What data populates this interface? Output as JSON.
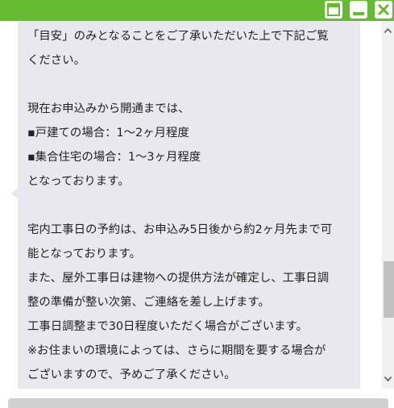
{
  "window": {
    "controls": [
      "restore-icon",
      "minimize-icon",
      "close-icon"
    ],
    "titlebar_color": "#66b933"
  },
  "message": {
    "lines": [
      "「目安」のみとなることをご了承いただいた上で下記ご覧",
      "ください。",
      "",
      "現在お申込みから開通までは、",
      "▪戸建ての場合：1～2ヶ月程度",
      "▪集合住宅の場合：1～3ヶ月程度",
      "となっております。",
      "",
      "宅内工事日の予約は、お申込み5日後から約2ヶ月先まで可",
      "能となっております。",
      "また、屋外工事日は建物への提供方法が確定し、工事日調",
      "整の準備が整い次第、ご連絡を差し上げます。",
      "工事日調整まで30日程度いただく場合がございます。",
      "※お住まいの環境によっては、さらに期間を要する場合が",
      "ございますので、予めご了承ください。"
    ],
    "bubble_color": "#e8e8ee"
  }
}
